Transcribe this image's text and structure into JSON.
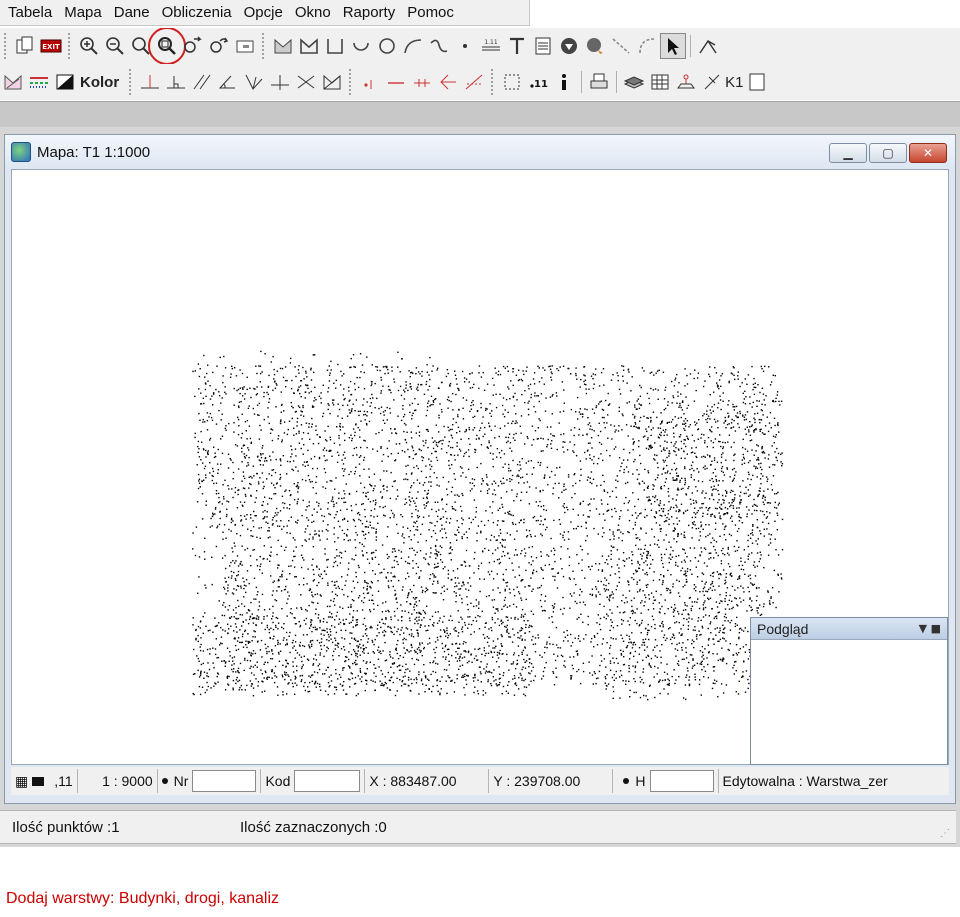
{
  "menu": [
    {
      "label": "Tabela"
    },
    {
      "label": "Mapa"
    },
    {
      "label": "Dane"
    },
    {
      "label": "Obliczenia"
    },
    {
      "label": "Opcje"
    },
    {
      "label": "Okno"
    },
    {
      "label": "Raporty"
    },
    {
      "label": "Pomoc"
    }
  ],
  "toolbar2": {
    "kolor_label": "Kolor",
    "k1_label": "K1"
  },
  "map_window": {
    "title": "Mapa: T1  1:1000",
    "preview_title": "Podgląd"
  },
  "window_status": {
    "point_size": ",11",
    "scale": "1 : 9000",
    "nr_label": "Nr",
    "nr_value": "",
    "kod_label": "Kod",
    "kod_value": "",
    "x_readout": "X : 883487.00",
    "y_readout": "Y : 239708.00",
    "h_label": "H",
    "h_value": "",
    "layer_status": "Edytowalna : Warstwa_zer"
  },
  "app_status": {
    "points_count": "Ilość punktów :1",
    "selected_count": "Ilość zaznaczonych :0"
  },
  "caption": "Dodaj warstwy: Budynki, drogi, kanaliz",
  "colors": {
    "caption": "#cc0000",
    "highlight_ring": "#d02020",
    "close_button": "#c6452d"
  }
}
